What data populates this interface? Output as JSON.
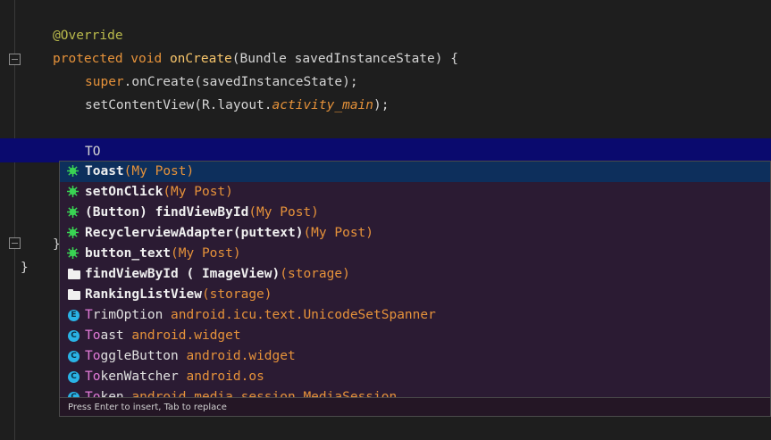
{
  "editor": {
    "lines": {
      "l1": "@Override",
      "l2_kw": "protected void ",
      "l2_fn": "onCreate",
      "l2_rest": "(Bundle savedInstanceState) {",
      "l3_kw": "super",
      "l3_rest": ".onCreate(savedInstanceState);",
      "l4_a": "setContentView(R.layout.",
      "l4_it": "activity_main",
      "l4_b": ");",
      "l5_typed": "TO",
      "l6": "}",
      "l7": "}"
    }
  },
  "completion": {
    "items": [
      {
        "match": "To",
        "rest": "ast",
        "src": "(My Post)",
        "icon": "live-template-icon"
      },
      {
        "match": "",
        "rest": "setOnClick",
        "src": "(My Post)",
        "icon": "live-template-icon"
      },
      {
        "match": "",
        "rest": "(Button) findViewById",
        "src": "(My Post)",
        "icon": "live-template-icon"
      },
      {
        "match": "",
        "rest": "RecyclerviewAdapter(puttext)",
        "src": "(My Post)",
        "icon": "live-template-icon"
      },
      {
        "match": "",
        "rest": "button_text",
        "src": "(My Post)",
        "icon": "live-template-icon"
      },
      {
        "match": "",
        "rest": "findViewById ( ImageView)",
        "src": "(storage)",
        "icon": "folder-icon"
      },
      {
        "match": "",
        "rest": "RankingListView",
        "src": "(storage)",
        "icon": "folder-icon"
      },
      {
        "match": "T",
        "rest": "rimOption",
        "src": "android.icu.text.UnicodeSetSpanner",
        "icon": "enum-icon",
        "letter": "E"
      },
      {
        "match": "To",
        "rest": "ast",
        "src": "android.widget",
        "icon": "class-icon",
        "letter": "C"
      },
      {
        "match": "To",
        "rest": "ggleButton",
        "src": "android.widget",
        "icon": "class-icon",
        "letter": "C"
      },
      {
        "match": "To",
        "rest": "kenWatcher",
        "src": "android.os",
        "icon": "class-icon",
        "letter": "C"
      },
      {
        "match": "To",
        "rest": "ken",
        "src": "android.media.session.MediaSession",
        "icon": "class-icon",
        "letter": "C"
      }
    ],
    "footer": "Press Enter to insert, Tab to replace"
  }
}
